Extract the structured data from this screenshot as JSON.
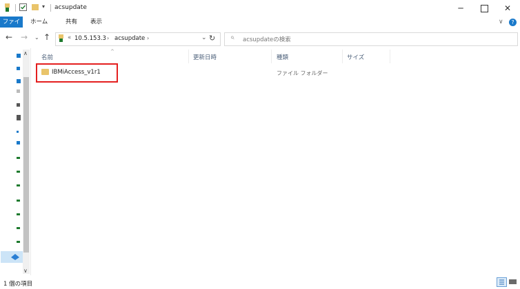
{
  "window": {
    "title": "acsupdate"
  },
  "ribbon": {
    "tabs": [
      "ファイル",
      "ホーム",
      "共有",
      "表示"
    ]
  },
  "address": {
    "segments": [
      "10.5.153.3",
      "acsupdate"
    ],
    "overflow": "«"
  },
  "search": {
    "placeholder": "acsupdateの検索"
  },
  "columns": [
    "名前",
    "更新日時",
    "種類",
    "サイズ"
  ],
  "rows": [
    {
      "name": "IBMiAccess_v1r1",
      "modified": "",
      "type": "ファイル フォルダー",
      "size": ""
    }
  ],
  "status": {
    "count_text": "1 個の項目"
  },
  "colors": {
    "accent": "#1979ca",
    "highlight_border": "#e41e1e",
    "folder": "#e9c46a"
  }
}
